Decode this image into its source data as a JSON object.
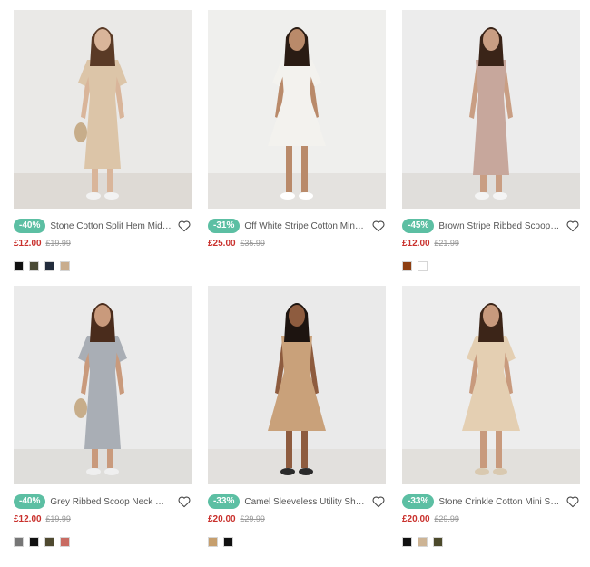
{
  "products": [
    {
      "discount": "-40%",
      "title": "Stone Cotton Split Hem Midi Dress",
      "price": "£12.00",
      "was": "£19.99",
      "swatches": [
        "#111111",
        "#4a4a35",
        "#232c3c",
        "#c9ad8e"
      ],
      "colors": {
        "bg": "#eae9e7",
        "floor": "#dedad5",
        "dress": "#dcc5a8",
        "skin": "#d9b59a",
        "hair": "#5a3a26",
        "shoe": "#f2f2f2"
      }
    },
    {
      "discount": "-31%",
      "title": "Off White Stripe Cotton Mini Dress",
      "price": "£25.00",
      "was": "£35.99",
      "swatches": [],
      "colors": {
        "bg": "#efefed",
        "floor": "#e4e2df",
        "dress": "#f3f2ee",
        "skin": "#b98a6a",
        "hair": "#2a1c14",
        "shoe": "#ffffff"
      }
    },
    {
      "discount": "-45%",
      "title": "Brown Stripe Ribbed Scoop Neck Midi Dress",
      "price": "£12.00",
      "was": "£21.99",
      "swatches": [
        "#8e3f12",
        "#ffffff"
      ],
      "colors": {
        "bg": "#ececec",
        "floor": "#e0dedb",
        "dress": "#c7a79c",
        "skin": "#c99e83",
        "hair": "#3a2418",
        "shoe": "#f4f4f4"
      }
    },
    {
      "discount": "-40%",
      "title": "Grey Ribbed Scoop Neck Midi Dress",
      "price": "£12.00",
      "was": "£19.99",
      "swatches": [
        "#767676",
        "#111111",
        "#4f4a30",
        "#c86b62"
      ],
      "colors": {
        "bg": "#ebebeb",
        "floor": "#dfdedb",
        "dress": "#a9aeb5",
        "skin": "#c99a7c",
        "hair": "#4a2c1c",
        "shoe": "#efefef"
      }
    },
    {
      "discount": "-33%",
      "title": "Camel Sleeveless Utility Shirt Mini Dress",
      "price": "£20.00",
      "was": "£29.99",
      "swatches": [
        "#c69f6e",
        "#111111"
      ],
      "colors": {
        "bg": "#eaeaea",
        "floor": "#e2e0dd",
        "dress": "#c9a17a",
        "skin": "#8e5c3f",
        "hair": "#1d1410",
        "shoe": "#2a2a2a"
      }
    },
    {
      "discount": "-33%",
      "title": "Stone Crinkle Cotton Mini Smock Dress",
      "price": "£20.00",
      "was": "£29.99",
      "swatches": [
        "#111111",
        "#cdb495",
        "#4c4a2c"
      ],
      "colors": {
        "bg": "#ededed",
        "floor": "#e2e0dc",
        "dress": "#e4cfb2",
        "skin": "#c89a7d",
        "hair": "#3c2518",
        "shoe": "#d9c9b0"
      }
    }
  ]
}
